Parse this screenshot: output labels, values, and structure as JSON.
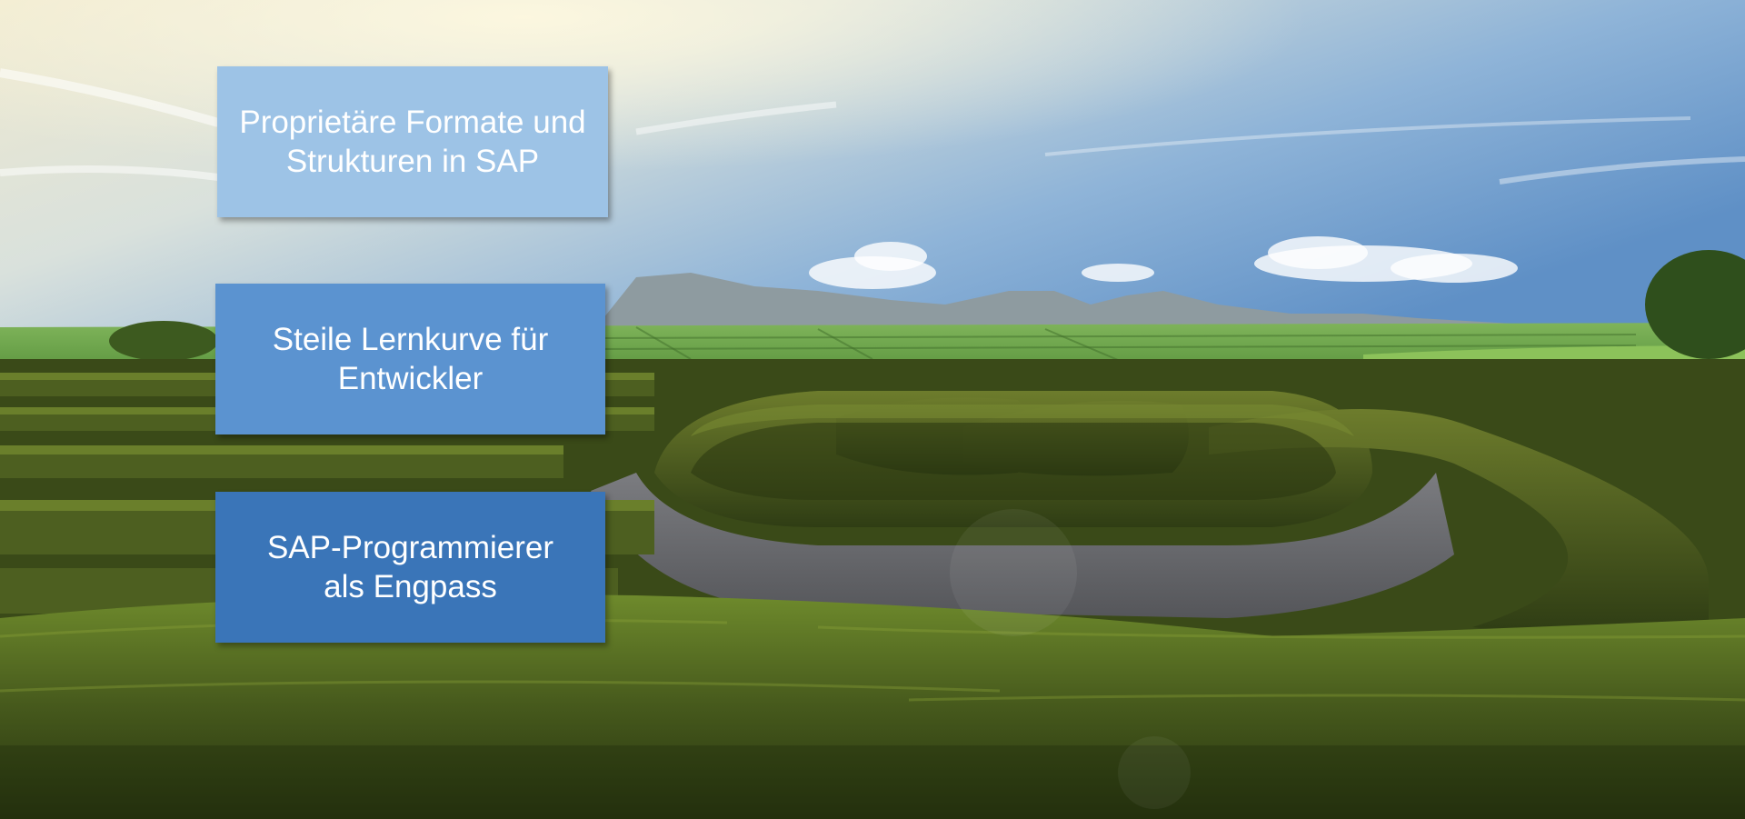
{
  "slide": {
    "boxes": [
      {
        "line1": "Proprietäre Formate und",
        "line2": "Strukturen in SAP",
        "color": "#9dc3e6"
      },
      {
        "line1": "Steile Lernkurve für",
        "line2": "Entwickler",
        "color": "#5b93d0"
      },
      {
        "line1": "SAP-Programmierer",
        "line2": "als Engpass",
        "color": "#3a75b8"
      }
    ],
    "background": {
      "sky_top": "#6f9fd0",
      "sky_haze": "#ece6c8",
      "mountains": "#8a9aa2",
      "fields": "#6fa64a",
      "hedge_dark": "#3a4a1a",
      "hedge_light": "#7c8e34",
      "path": "#6b6b6e"
    }
  }
}
